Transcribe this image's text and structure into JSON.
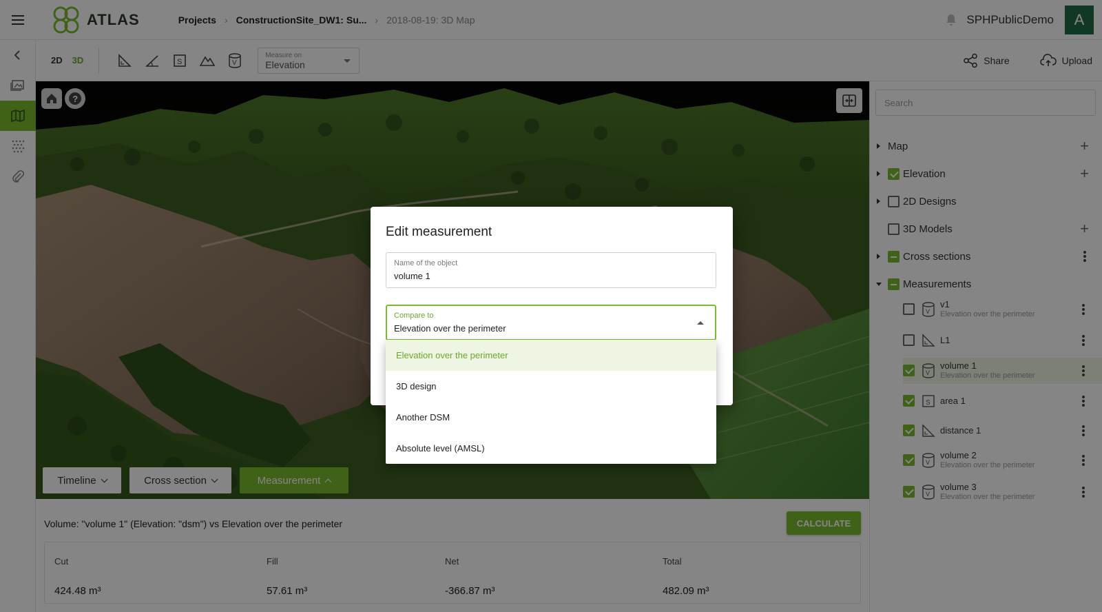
{
  "app": {
    "name": "ATLAS"
  },
  "breadcrumb": [
    "Projects",
    "ConstructionSite_DW1: Su...",
    "2018-08-19: 3D Map"
  ],
  "user": {
    "name": "SPHPublicDemo",
    "initial": "A"
  },
  "toolbar": {
    "mode_2d": "2D",
    "mode_3d": "3D",
    "measure_on_label": "Measure on",
    "measure_on_value": "Elevation",
    "share": "Share",
    "upload": "Upload"
  },
  "map": {
    "tabs": [
      "Timeline",
      "Cross section",
      "Measurement"
    ],
    "active_tab": "Measurement"
  },
  "results": {
    "title": "Volume: \"volume 1\" (Elevation: \"dsm\") vs Elevation over the perimeter",
    "calculate": "CALCULATE",
    "columns": [
      {
        "label": "Cut",
        "value": "424.48 m³"
      },
      {
        "label": "Fill",
        "value": "57.61 m³"
      },
      {
        "label": "Net",
        "value": "-366.87 m³"
      },
      {
        "label": "Total",
        "value": "482.09 m³"
      }
    ]
  },
  "sidebar": {
    "search_placeholder": "Search",
    "layers": [
      {
        "name": "Map",
        "checkbox": "none",
        "action": "+"
      },
      {
        "name": "Elevation",
        "checkbox": "checked",
        "action": "+"
      },
      {
        "name": "2D Designs",
        "checkbox": "unchecked",
        "action": ""
      },
      {
        "name": "3D Models",
        "checkbox": "unchecked",
        "action": "+"
      },
      {
        "name": "Cross sections",
        "checkbox": "partial",
        "action": "⋮"
      },
      {
        "name": "Measurements",
        "checkbox": "partial",
        "action": "⋮"
      }
    ],
    "measurements": [
      {
        "name": "v1",
        "sub": "Elevation over the perimeter",
        "type": "volume",
        "checked": false
      },
      {
        "name": "L1",
        "sub": "",
        "type": "distance",
        "checked": false
      },
      {
        "name": "volume 1",
        "sub": "Elevation over the perimeter",
        "type": "volume",
        "checked": true,
        "selected": true
      },
      {
        "name": "area 1",
        "sub": "",
        "type": "area",
        "checked": true
      },
      {
        "name": "distance 1",
        "sub": "",
        "type": "distance",
        "checked": true
      },
      {
        "name": "volume 2",
        "sub": "Elevation over the perimeter",
        "type": "volume",
        "checked": true
      },
      {
        "name": "volume 3",
        "sub": "Elevation over the perimeter",
        "type": "volume",
        "checked": true
      }
    ]
  },
  "dialog": {
    "title": "Edit measurement",
    "name_label": "Name of the object",
    "name_value": "volume 1",
    "compare_label": "Compare to",
    "compare_value": "Elevation over the perimeter",
    "options": [
      "Elevation over the perimeter",
      "3D design",
      "Another DSM",
      "Absolute level (AMSL)"
    ],
    "selected_option": "Elevation over the perimeter"
  },
  "colors": {
    "accent": "#7cbb2e",
    "avatar": "#1f6b47",
    "selected_bg": "#eef5e2"
  }
}
